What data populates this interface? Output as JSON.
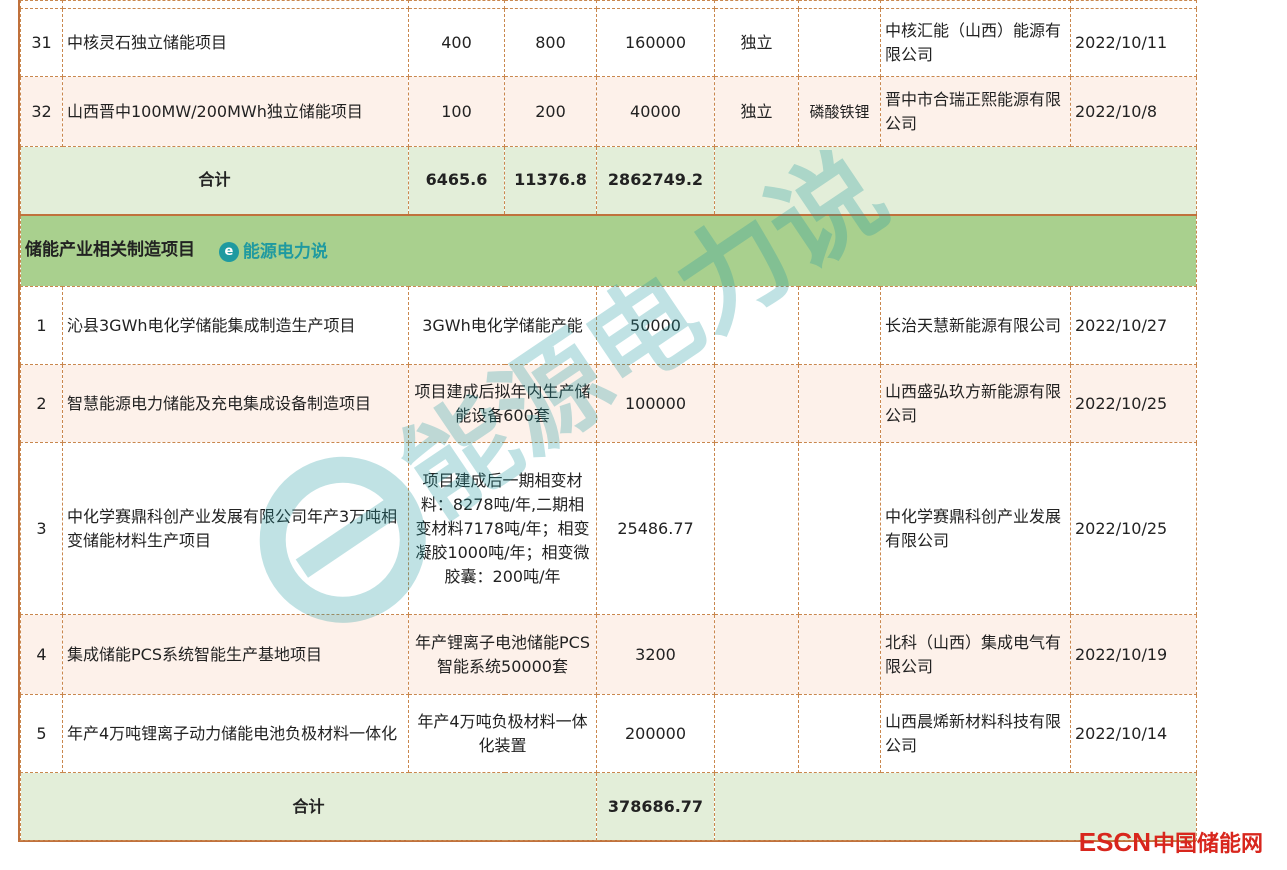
{
  "top_rows": [
    {
      "idx": "31",
      "name": "中核灵石独立储能项目",
      "mw": "400",
      "mwh": "800",
      "invest": "160000",
      "type": "独立",
      "tech": "",
      "company": "中核汇能（山西）能源有限公司",
      "date": "2022/10/11"
    },
    {
      "idx": "32",
      "name": "山西晋中100MW/200MWh独立储能项目",
      "mw": "100",
      "mwh": "200",
      "invest": "40000",
      "type": "独立",
      "tech": "磷酸铁锂",
      "company": "晋中市合瑞正熙能源有限公司",
      "date": "2022/10/8"
    }
  ],
  "total1": {
    "label": "合计",
    "mw": "6465.6",
    "mwh": "11376.8",
    "invest": "2862749.2"
  },
  "section": {
    "title": "储能产业相关制造项目",
    "brand": "能源电力说",
    "brand_icon": "e-logo-icon"
  },
  "mfg_rows": [
    {
      "idx": "1",
      "name": "沁县3GWh电化学储能集成制造生产项目",
      "capacity": "3GWh电化学储能产能",
      "invest": "50000",
      "company": "长治天慧新能源有限公司",
      "date": "2022/10/27"
    },
    {
      "idx": "2",
      "name": "智慧能源电力储能及充电集成设备制造项目",
      "capacity": "项目建成后拟年内生产储能设备600套",
      "invest": "100000",
      "company": "山西盛弘玖方新能源有限公司",
      "date": "2022/10/25"
    },
    {
      "idx": "3",
      "name": "中化学赛鼎科创产业发展有限公司年产3万吨相变储能材料生产项目",
      "capacity": "项目建成后一期相变材料：8278吨/年,二期相变材料7178吨/年；相变凝胶1000吨/年；相变微胶囊：200吨/年",
      "invest": "25486.77",
      "company": "中化学赛鼎科创产业发展有限公司",
      "date": "2022/10/25"
    },
    {
      "idx": "4",
      "name": "集成储能PCS系统智能生产基地项目",
      "capacity": "年产锂离子电池储能PCS智能系统50000套",
      "invest": "3200",
      "company": "北科（山西）集成电气有限公司",
      "date": "2022/10/19"
    },
    {
      "idx": "5",
      "name": "年产4万吨锂离子动力储能电池负极材料一体化",
      "capacity": "年产4万吨负极材料一体化装置",
      "invest": "200000",
      "company": "山西晨烯新材料科技有限公司",
      "date": "2022/10/14"
    }
  ],
  "total2": {
    "label": "合计",
    "invest": "378686.77"
  },
  "watermark": {
    "text": "能源电力说"
  },
  "footer_logo": {
    "latin": "ESCN",
    "cn": "中国储能网"
  },
  "colors": {
    "border": "#c0713c",
    "section_bg": "#a9d08e",
    "total_bg": "#e3eed9",
    "row_tint": "#fdf1ea",
    "brand": "#1f9aa0",
    "escn_red": "#d8261d"
  }
}
